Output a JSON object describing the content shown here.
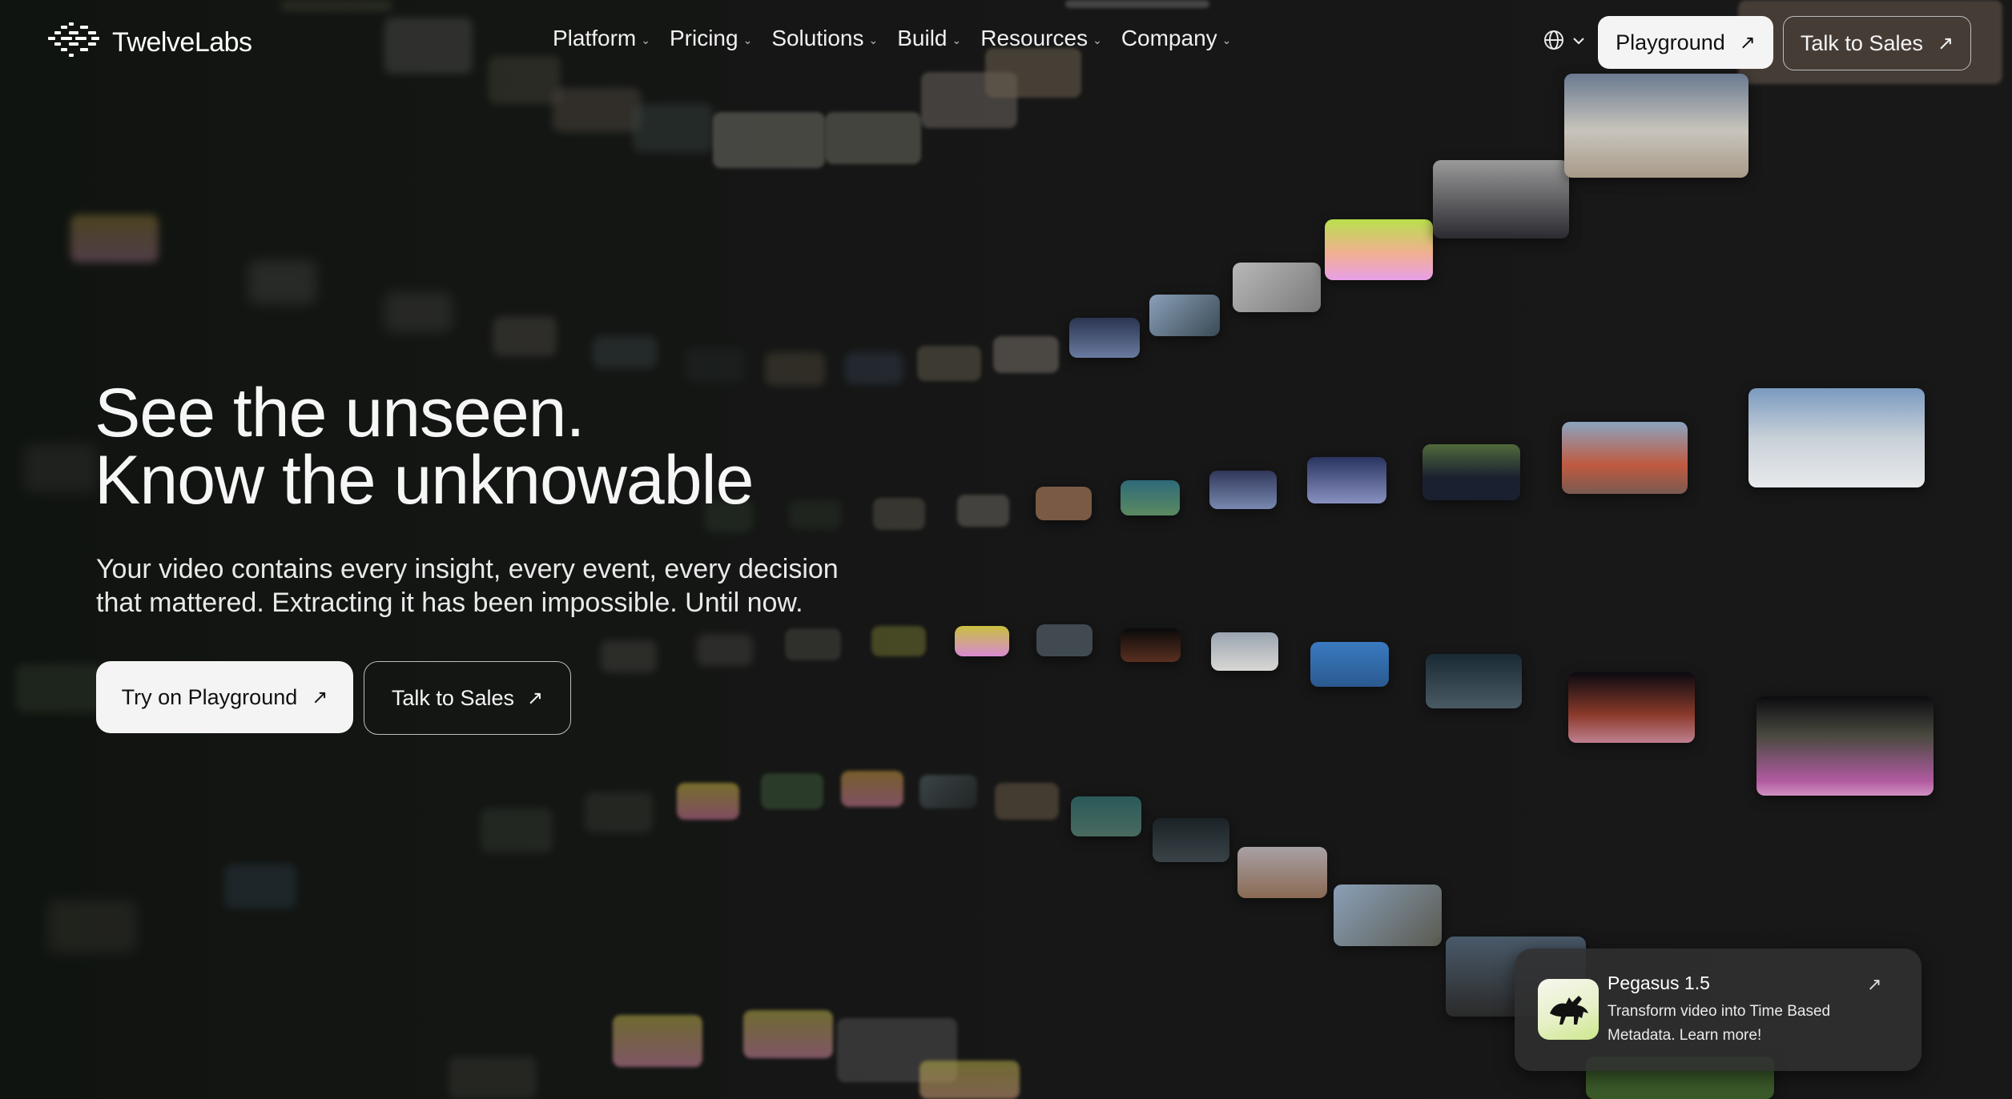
{
  "brand": {
    "name": "TwelveLabs"
  },
  "nav": {
    "items": [
      {
        "label": "Platform"
      },
      {
        "label": "Pricing"
      },
      {
        "label": "Solutions"
      },
      {
        "label": "Build"
      },
      {
        "label": "Resources"
      },
      {
        "label": "Company"
      }
    ],
    "playground_label": "Playground",
    "talk_to_sales_label": "Talk to Sales"
  },
  "hero": {
    "headline_line1": "See the unseen.",
    "headline_line2": "Know the unknowable",
    "subtext": "Your video contains every insight, every event, every decision that mattered. Extracting it has been impossible. Until now.",
    "try_label": "Try on Playground",
    "sales_label": "Talk to Sales"
  },
  "promo": {
    "title": "Pegasus 1.5",
    "description": "Transform video into Time Based Metadata. Learn more!"
  },
  "icons": {
    "logo": "twelvelabs-logo-icon",
    "caret": "chevron-down-icon",
    "globe": "globe-icon",
    "arrow": "arrow-up-right-icon",
    "pegasus": "pegasus-horse-icon"
  },
  "colors": {
    "background": "#171717",
    "primary_button": "#f4f4f4",
    "text": "#f2f2f2",
    "promo_card": "#303030"
  }
}
